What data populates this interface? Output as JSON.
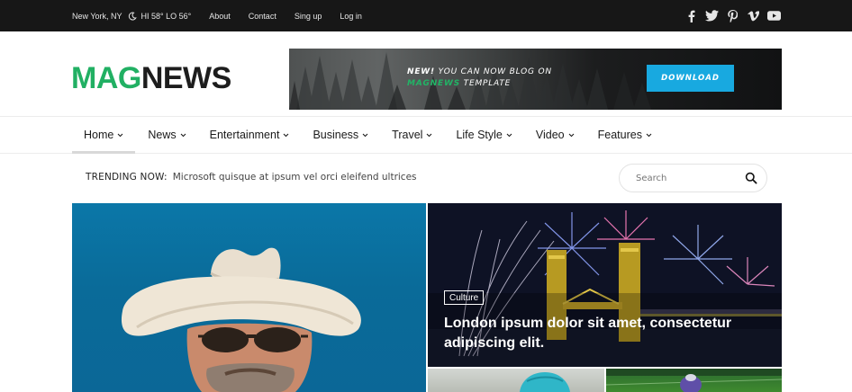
{
  "topbar": {
    "location": "New York, NY",
    "weather": "HI 58° LO 56°",
    "links": [
      "About",
      "Contact",
      "Sing up",
      "Log in"
    ],
    "social_icons": [
      "facebook-icon",
      "twitter-icon",
      "pinterest-icon",
      "vimeo-icon",
      "youtube-icon"
    ]
  },
  "logo": {
    "part1": "MAG",
    "part2": "NEWS",
    "color_part1": "#21b063"
  },
  "banner": {
    "text_bold": "NEW!",
    "text_rest": " YOU CAN NOW BLOG ON",
    "text_brand": "MAGNEWS",
    "text_after": " TEMPLATE",
    "button": "DOWNLOAD",
    "button_color": "#18a9e0"
  },
  "mainnav": {
    "items": [
      "Home",
      "News",
      "Entertainment",
      "Business",
      "Travel",
      "Life Style",
      "Video",
      "Features"
    ],
    "active": "Home"
  },
  "trending": {
    "label": "TRENDING NOW:",
    "title": "Microsoft quisque at ipsum vel orci eleifend ultrices"
  },
  "search": {
    "placeholder": "Search"
  },
  "featured": {
    "secondary": {
      "category": "Culture",
      "headline": "London ipsum dolor sit amet, consectetur adipiscing elit."
    }
  }
}
